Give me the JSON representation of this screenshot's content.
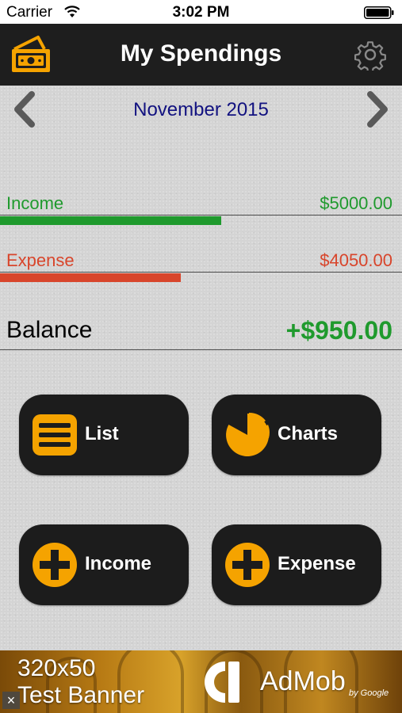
{
  "status_bar": {
    "carrier": "Carrier",
    "time": "3:02 PM",
    "wifi_icon": "wifi-icon",
    "battery_icon": "battery-icon"
  },
  "nav": {
    "title": "My Spendings",
    "left_icon": "wallet-icon",
    "right_icon": "gear-icon"
  },
  "month": {
    "label": "November 2015",
    "prev_icon": "chevron-left-icon",
    "next_icon": "chevron-right-icon"
  },
  "summary": {
    "income": {
      "label": "Income",
      "amount": "$5000.00",
      "bar_fraction": 0.55,
      "color": "#1f9a2d"
    },
    "expense": {
      "label": "Expense",
      "amount": "$4050.00",
      "bar_fraction": 0.45,
      "color": "#d8452b"
    },
    "balance": {
      "label": "Balance",
      "amount": "+$950.00",
      "color": "#1f9a2d"
    }
  },
  "actions": {
    "list": {
      "label": "List",
      "icon": "list-icon"
    },
    "charts": {
      "label": "Charts",
      "icon": "pie-chart-icon"
    },
    "income": {
      "label": "Income",
      "icon": "plus-circle-icon"
    },
    "expense": {
      "label": "Expense",
      "icon": "plus-circle-icon"
    }
  },
  "ad_banner": {
    "size_text": "320x50",
    "test_text": "Test Banner",
    "brand": "AdMob",
    "by_text": "by Google",
    "close_symbol": "×"
  },
  "colors": {
    "accent": "#f5a300",
    "nav_background": "#1e1e1e",
    "button_background": "#1c1c1c",
    "month_text": "#121280"
  }
}
